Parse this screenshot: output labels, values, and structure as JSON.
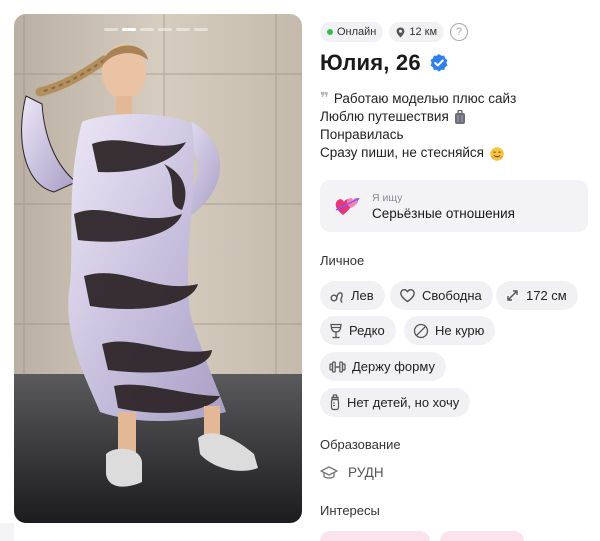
{
  "photo": {
    "indicator_count": 6,
    "active_indicator": 1
  },
  "status": {
    "online_label": "Онлайн",
    "distance": "12 км",
    "help_glyph": "?"
  },
  "profile": {
    "name_age": "Юлия, 26",
    "verified": true
  },
  "bio": {
    "lines": [
      "Работаю моделью плюс сайз",
      "Люблю путешествия",
      "Понравилась",
      "Сразу пиши, не стесняйся"
    ]
  },
  "looking_for": {
    "label": "Я ищу",
    "value": "Серьёзные отношения",
    "icon": "hearts-icon"
  },
  "personal": {
    "title": "Личное",
    "tags": [
      {
        "label": "Лев",
        "icon": "leo-zodiac-icon"
      },
      {
        "label": "Свободна",
        "icon": "heart-outline-icon"
      },
      {
        "label": "172 см",
        "icon": "height-arrows-icon"
      },
      {
        "label": "Редко",
        "icon": "wine-glass-icon"
      },
      {
        "label": "Не курю",
        "icon": "no-smoking-icon"
      },
      {
        "label": "Держу форму",
        "icon": "dumbbell-icon"
      },
      {
        "label": "Нет детей, но хочу",
        "icon": "baby-bottle-icon"
      }
    ]
  },
  "education": {
    "title": "Образование",
    "value": "РУДН",
    "icon": "graduation-cap-icon"
  },
  "interests": {
    "title": "Интересы"
  },
  "colors": {
    "online": "#31c056",
    "verified": "#2f80ed",
    "chip_bg": "#f1f1f4",
    "interest_chip": "#fbe3ee"
  }
}
